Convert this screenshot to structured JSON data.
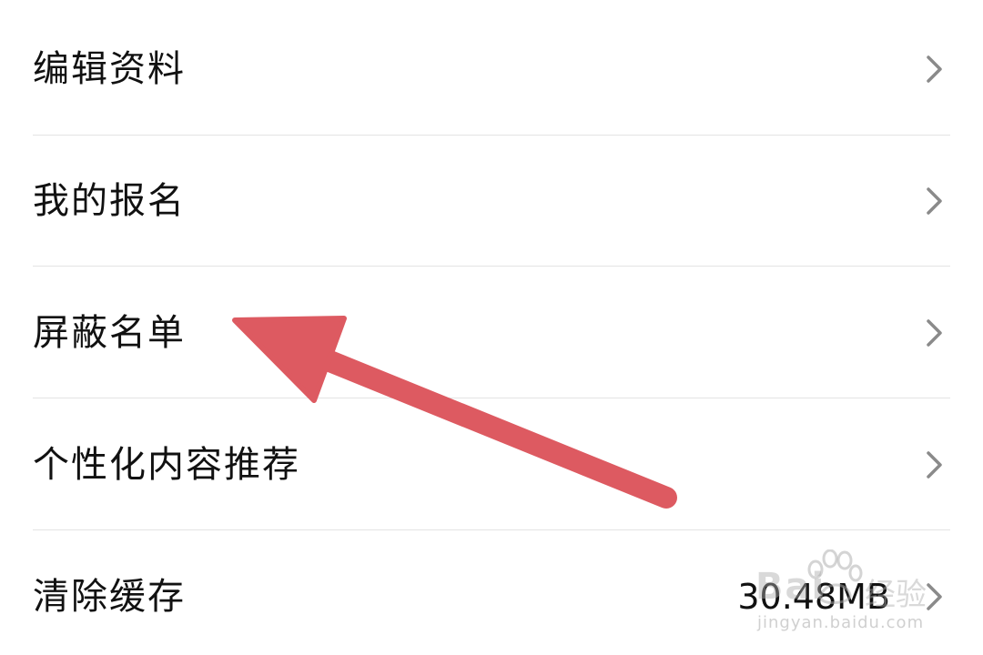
{
  "settings": {
    "items": [
      {
        "label": "编辑资料",
        "value": ""
      },
      {
        "label": "我的报名",
        "value": ""
      },
      {
        "label": "屏蔽名单",
        "value": ""
      },
      {
        "label": "个性化内容推荐",
        "value": ""
      },
      {
        "label": "清除缓存",
        "value": "30.48MB"
      }
    ]
  },
  "annotation": {
    "arrow_color": "#DD5A61",
    "icon": "arrow-icon"
  },
  "watermark": {
    "brand": "Bai",
    "chinese": "经验",
    "url": "jingyan.baidu.com"
  },
  "colors": {
    "divider": "#e4e4e4",
    "chevron": "#8a8a8a",
    "text": "#111111"
  }
}
